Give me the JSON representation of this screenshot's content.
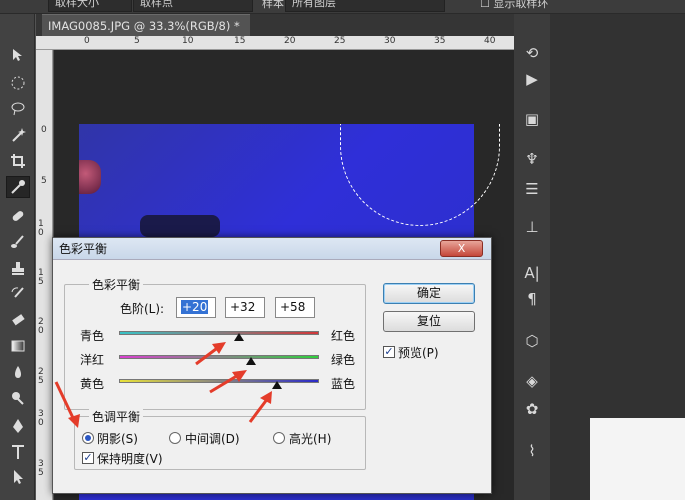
{
  "optbar": {
    "select1": "取样大小",
    "select2": "取样点",
    "label_sample": "样本",
    "select3": "所有图层",
    "show_ring": "显示取样环"
  },
  "document": {
    "tab_title": "IMAG0085.JPG @ 33.3%(RGB/8) *",
    "close": "×"
  },
  "rulers": {
    "h": [
      "0",
      "5",
      "10",
      "15",
      "20",
      "25",
      "30",
      "35",
      "40"
    ],
    "v": [
      "0",
      "5",
      "1 0",
      "1 5",
      "2 0",
      "2 5",
      "3 0",
      "3 5"
    ]
  },
  "dialog": {
    "title": "色彩平衡",
    "balance_group": "色彩平衡",
    "levels_label": "色阶(L):",
    "levels": [
      "+20",
      "+32",
      "+58"
    ],
    "sliders": [
      {
        "left": "青色",
        "right": "红色",
        "value": 20,
        "colors": [
          "#38c3c6",
          "#d2383a"
        ]
      },
      {
        "left": "洋红",
        "right": "绿色",
        "value": 32,
        "colors": [
          "#d93fd0",
          "#2fcf3d"
        ]
      },
      {
        "left": "黄色",
        "right": "蓝色",
        "value": 58,
        "colors": [
          "#e8e13a",
          "#2a2ac8"
        ]
      }
    ],
    "tone_group": "色调平衡",
    "tones": [
      {
        "label": "阴影(S)",
        "selected": true
      },
      {
        "label": "中间调(D)",
        "selected": false
      },
      {
        "label": "高光(H)",
        "selected": false
      }
    ],
    "preserve_luminosity": "保持明度(V)",
    "preserve_checked": true,
    "ok": "确定",
    "reset": "复位",
    "preview": "预览(P)",
    "preview_checked": true,
    "close": "X"
  },
  "annotation_color": "#e43c2a"
}
